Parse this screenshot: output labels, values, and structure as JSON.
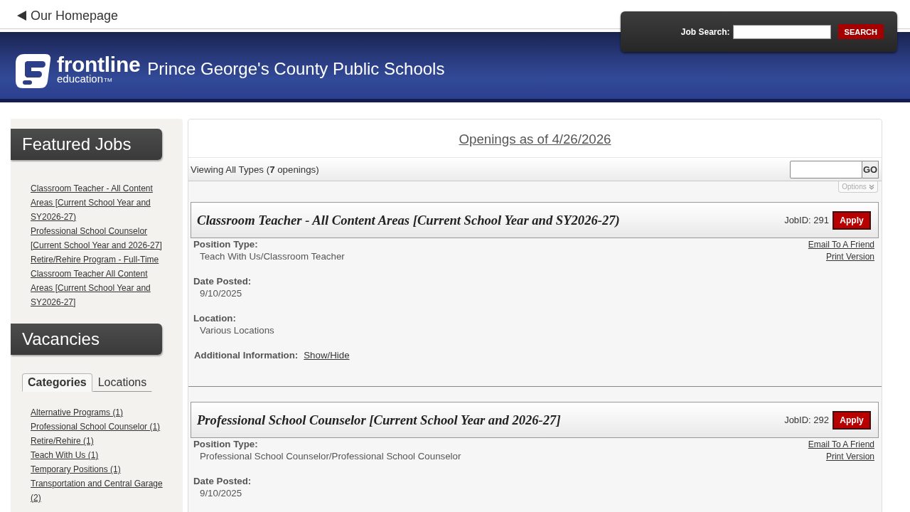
{
  "top_link": {
    "label": "Our Homepage"
  },
  "job_search": {
    "label": "Job Search:",
    "button": "SEARCH"
  },
  "banner": {
    "logo": {
      "name": "frontline",
      "tagline": "education",
      "trademark": "TM"
    },
    "title": "Prince George's County Public Schools"
  },
  "sidebar": {
    "featured_jobs": {
      "title": "Featured Jobs",
      "links": [
        "Classroom Teacher - All Content Areas [Current School Year and SY2026-27)",
        "Professional School Counselor [Current School Year and 2026-27]",
        "Retire/Rehire Program - Full-Time Classroom Teacher All Content Areas [Current School Year and SY2026-27]"
      ]
    },
    "vacancies": {
      "title": "Vacancies",
      "tabs": [
        {
          "label": "Categories",
          "selected": true
        },
        {
          "label": "Locations",
          "selected": false
        }
      ],
      "links": [
        "Alternative Programs (1)",
        "Professional School Counselor (1)",
        "Retire/Rehire (1)",
        "Teach With Us (1)",
        "Temporary Positions (1)",
        "Transportation and Central Garage (2)"
      ]
    }
  },
  "openings": {
    "heading": "Openings as of 4/26/2026",
    "summary": "Viewing All Types (**7** openings)",
    "go_button": "GO",
    "options_button": "Options",
    "jobs": [
      {
        "title": "Classroom Teacher - All Content Areas [Current School Year and SY2026-27)",
        "job_id": "JobID: 291",
        "apply_button": "Apply",
        "links": [
          "Email To A Friend",
          "Print Version"
        ],
        "fields": [
          {
            "label": "Position Type:",
            "value": "Teach With Us/Classroom Teacher"
          },
          {
            "label": "Date Posted:",
            "value": "9/10/2025"
          },
          {
            "label": "Location:",
            "value": "Various Locations"
          }
        ],
        "additional_info": {
          "label": "Additional Information:",
          "link": "Show/Hide"
        }
      },
      {
        "title": "Professional School Counselor [Current School Year and 2026-27]",
        "job_id": "JobID: 292",
        "apply_button": "Apply",
        "links": [
          "Email To A Friend",
          "Print Version"
        ],
        "fields": [
          {
            "label": "Position Type:",
            "value": "Professional School Counselor/Professional School Counselor"
          },
          {
            "label": "Date Posted:",
            "value": "9/10/2025"
          }
        ]
      }
    ]
  }
}
